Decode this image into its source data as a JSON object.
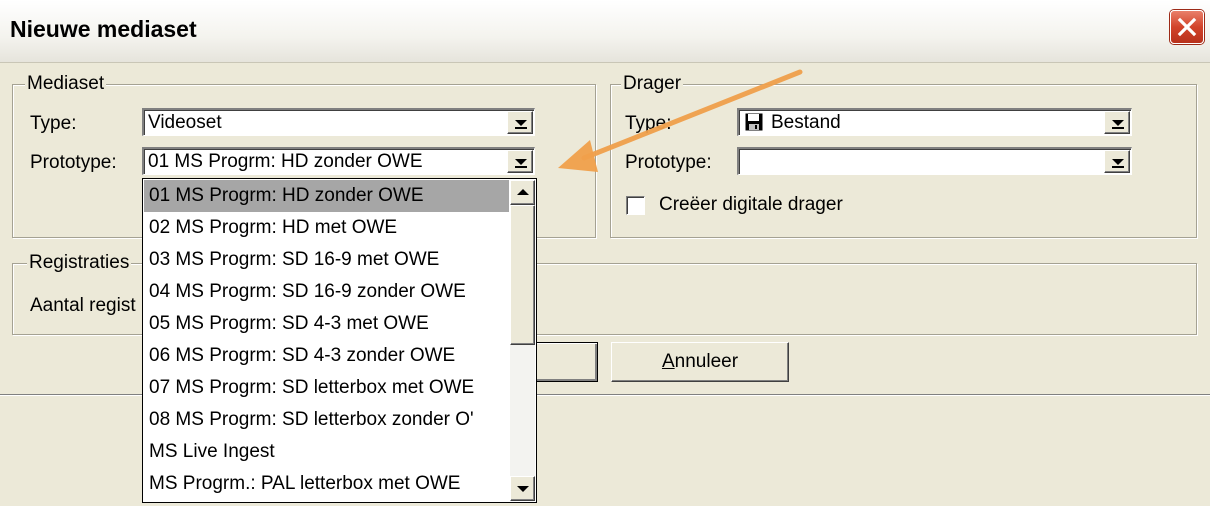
{
  "window": {
    "title": "Nieuwe mediaset"
  },
  "mediaset": {
    "legend": "Mediaset",
    "type_label": "Type:",
    "type_value": "Videoset",
    "prototype_label": "Prototype:",
    "prototype_value": "01 MS Progrm: HD zonder OWE"
  },
  "drager": {
    "legend": "Drager",
    "type_label": "Type:",
    "type_value": "Bestand",
    "type_icon": "floppy-disk-icon",
    "prototype_label": "Prototype:",
    "prototype_value": "",
    "checkbox_label": "Creëer digitale drager",
    "checkbox_checked": false
  },
  "registraties": {
    "legend": "Registraties",
    "aantal_label": "Aantal regist"
  },
  "buttons": {
    "cancel_label_underlined": "A",
    "cancel_label_rest": "nnuleer"
  },
  "dropdown": {
    "selected_index": 0,
    "items": [
      "01 MS Progrm: HD zonder OWE",
      "02 MS Progrm: HD met OWE",
      "03 MS Progrm: SD 16-9 met OWE",
      "04 MS Progrm: SD 16-9 zonder OWE",
      "05 MS Progrm: SD 4-3 met OWE",
      "06 MS Progrm: SD 4-3 zonder OWE",
      "07 MS Progrm: SD letterbox met OWE",
      "08 MS Progrm: SD letterbox zonder O'",
      "MS Live Ingest",
      "MS Progrm.: PAL letterbox met OWE"
    ]
  },
  "colors": {
    "annotation_arrow": "#f0a04b",
    "close_button": "#d2432a",
    "selection_highlight": "#a6a6a6"
  }
}
